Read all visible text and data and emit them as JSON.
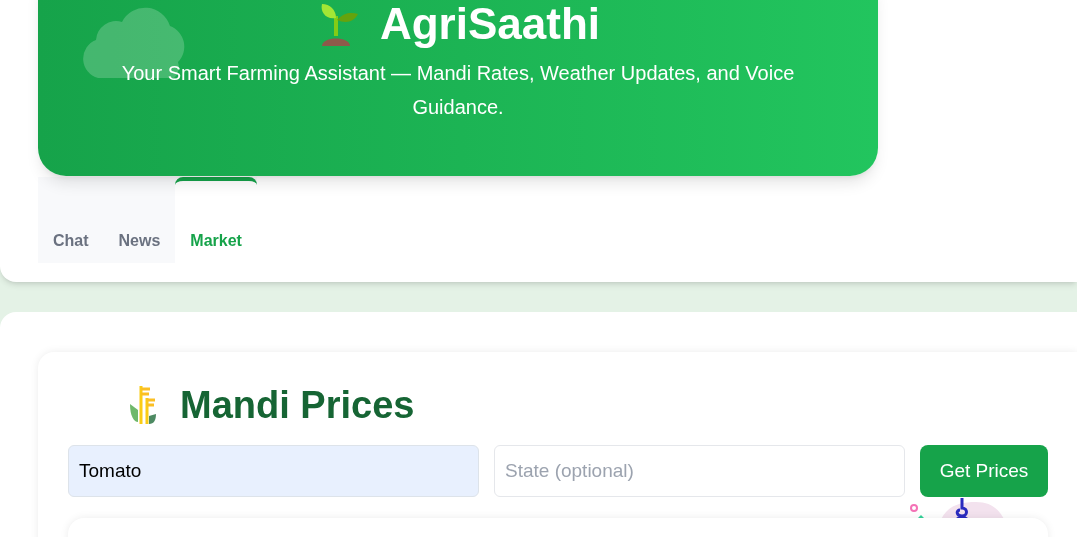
{
  "header": {
    "title": "AgriSaathi",
    "subtitle": "Your Smart Farming Assistant — Mandi Rates, Weather Updates, and Voice Guidance."
  },
  "tabs": [
    {
      "label": "Chat",
      "selected": false
    },
    {
      "label": "News",
      "selected": false
    },
    {
      "label": "Market",
      "selected": true
    }
  ],
  "mandi": {
    "title": "Mandi Prices",
    "commodity": {
      "value": "Tomato"
    },
    "state": {
      "placeholder": "State (optional)"
    },
    "button": "Get Prices"
  }
}
